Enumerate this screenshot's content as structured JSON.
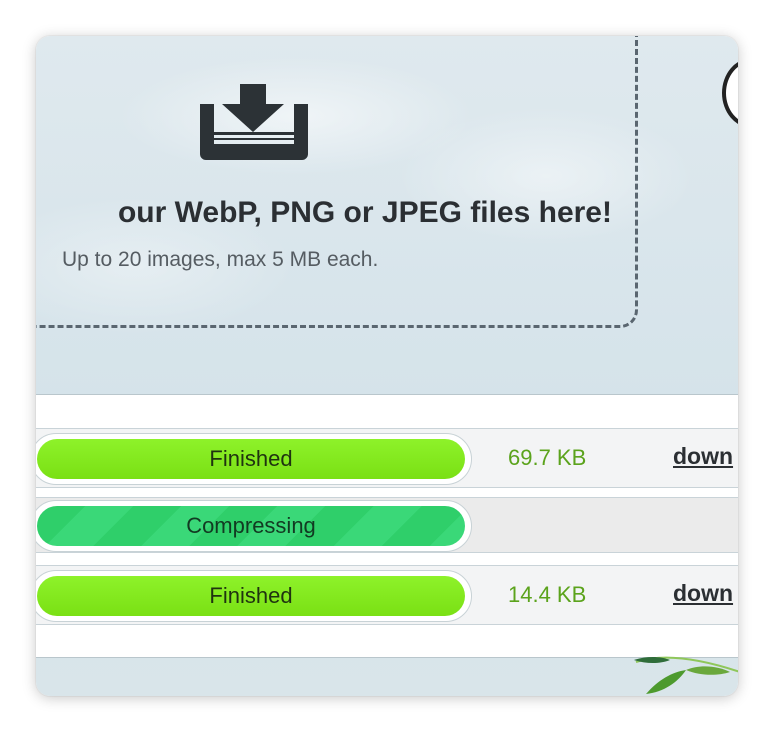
{
  "dropzone": {
    "title": "our WebP, PNG or JPEG files here!",
    "subtitle": "Up to 20 images, max 5 MB each."
  },
  "files": [
    {
      "status": "Finished",
      "size": "69.7 KB",
      "link": "down"
    },
    {
      "status": "Compressing",
      "size": "",
      "link": ""
    },
    {
      "status": "Finished",
      "size": "14.4 KB",
      "link": "down"
    }
  ],
  "colors": {
    "finished": "#7ae014",
    "compressing": "#2fcf6a",
    "size_text": "#5ba31c"
  },
  "icons": {
    "upload": "download-tray-icon",
    "mascot": "panda-icon",
    "decoration": "bamboo-leaf-icon"
  }
}
